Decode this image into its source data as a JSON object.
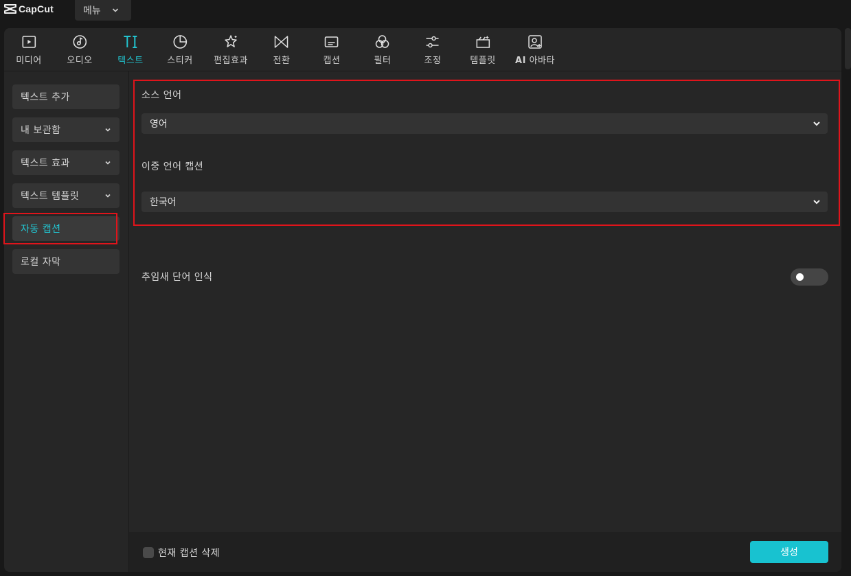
{
  "app": {
    "logo_text": "CapCut",
    "menu_label": "메뉴"
  },
  "toolbar": {
    "items": [
      {
        "label": "미디어",
        "icon": "media-icon"
      },
      {
        "label": "오디오",
        "icon": "audio-icon"
      },
      {
        "label": "텍스트",
        "icon": "text-icon",
        "active": true
      },
      {
        "label": "스티커",
        "icon": "sticker-icon"
      },
      {
        "label": "편집효과",
        "icon": "effects-icon"
      },
      {
        "label": "전환",
        "icon": "transition-icon"
      },
      {
        "label": "캡션",
        "icon": "caption-icon"
      },
      {
        "label": "필터",
        "icon": "filter-icon"
      },
      {
        "label": "조정",
        "icon": "adjust-icon"
      },
      {
        "label": "템플릿",
        "icon": "template-icon"
      },
      {
        "label_ai": "AI",
        "label_rest": " 아바타",
        "icon": "avatar-icon"
      }
    ],
    "accent_color": "#22c4d0"
  },
  "sidebar": {
    "items": [
      {
        "label": "텍스트 추가"
      },
      {
        "label": "내 보관함"
      },
      {
        "label": "텍스트 효과"
      },
      {
        "label": "텍스트 템플릿"
      },
      {
        "label": "자동 캡션",
        "active": true
      },
      {
        "label": "로컬 자막"
      }
    ]
  },
  "content": {
    "source_language_label": "소스 언어",
    "source_language_value": "영어",
    "bilingual_caption_label": "이중 언어 캡션",
    "bilingual_caption_value": "한국어",
    "filler_word_label": "추임새 단어 인식",
    "filler_word_enabled": false
  },
  "footer": {
    "delete_current_label": "현재 캡션 삭제",
    "generate_label": "생성",
    "generate_color": "#18c2d0"
  },
  "highlight_color": "#e0141b"
}
